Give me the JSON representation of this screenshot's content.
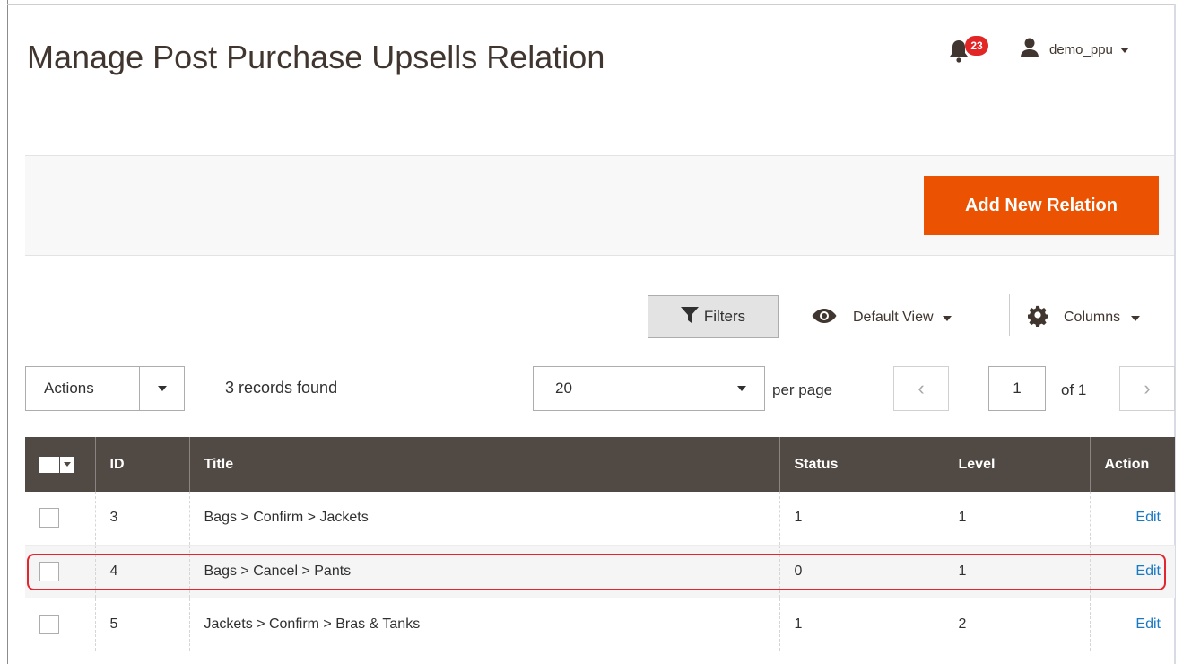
{
  "page": {
    "title": "Manage Post Purchase Upsells Relation"
  },
  "header": {
    "notifications_count": "23",
    "username": "demo_ppu"
  },
  "toolbar": {
    "add_button": "Add New Relation"
  },
  "grid_controls": {
    "filters_label": "Filters",
    "view_label": "Default View",
    "columns_label": "Columns",
    "actions_label": "Actions",
    "records_found": "3 records found",
    "per_page_value": "20",
    "per_page_label": "per page",
    "current_page": "1",
    "of_pages": "of 1",
    "prev_icon": "‹",
    "next_icon": "›"
  },
  "table": {
    "headers": [
      "ID",
      "Title",
      "Status",
      "Level",
      "Action"
    ],
    "rows": [
      {
        "id": "3",
        "title": "Bags > Confirm > Jackets",
        "status": "1",
        "level": "1",
        "action": "Edit"
      },
      {
        "id": "4",
        "title": "Bags > Cancel > Pants",
        "status": "0",
        "level": "1",
        "action": "Edit"
      },
      {
        "id": "5",
        "title": "Jackets > Confirm > Bras & Tanks",
        "status": "1",
        "level": "2",
        "action": "Edit"
      }
    ]
  },
  "colors": {
    "accent": "#eb5202",
    "header_bg": "#514943",
    "link": "#1979c3",
    "highlight": "#e3262e",
    "badge": "#e22626"
  },
  "icons": [
    "bell-icon",
    "user-icon",
    "chevron-down-icon",
    "filter-icon",
    "eye-icon",
    "gear-icon",
    "chevron-left-icon",
    "chevron-right-icon"
  ]
}
